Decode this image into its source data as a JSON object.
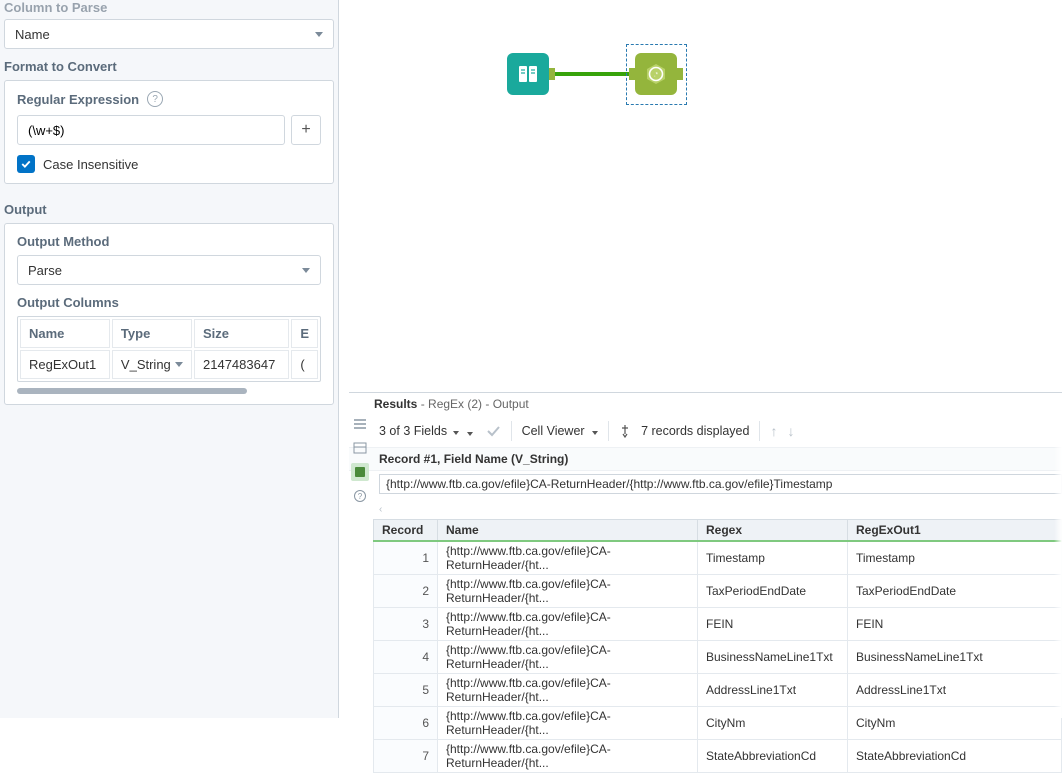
{
  "config": {
    "column_to_parse_label": "Column to Parse",
    "column_to_parse_value": "Name",
    "format_label": "Format to Convert",
    "regex_label": "Regular Expression",
    "regex_value": "(\\w+$)",
    "case_insensitive_label": "Case Insensitive",
    "output_label": "Output",
    "output_method_label": "Output Method",
    "output_method_value": "Parse",
    "output_columns_label": "Output Columns",
    "cols_headers": {
      "name": "Name",
      "type": "Type",
      "size": "Size",
      "expr": "E"
    },
    "cols_row": {
      "name": "RegExOut1",
      "type": "V_String",
      "size": "2147483647",
      "expr": "("
    }
  },
  "results": {
    "title_bold": "Results",
    "title_rest": " - RegEx (2) - Output",
    "toolbar": {
      "fields": "3 of 3 Fields",
      "cell_viewer": "Cell Viewer",
      "records": "7 records displayed"
    },
    "record_band": "Record #1, Field Name (V_String)",
    "record_value": "{http://www.ftb.ca.gov/efile}CA-ReturnHeader/{http://www.ftb.ca.gov/efile}Timestamp",
    "grid_headers": {
      "record": "Record",
      "name": "Name",
      "regex": "Regex",
      "out": "RegExOut1"
    },
    "rows": [
      {
        "n": "1",
        "name": "{http://www.ftb.ca.gov/efile}CA-ReturnHeader/{ht...",
        "regex": "Timestamp",
        "out": "Timestamp"
      },
      {
        "n": "2",
        "name": "{http://www.ftb.ca.gov/efile}CA-ReturnHeader/{ht...",
        "regex": "TaxPeriodEndDate",
        "out": "TaxPeriodEndDate"
      },
      {
        "n": "3",
        "name": "{http://www.ftb.ca.gov/efile}CA-ReturnHeader/{ht...",
        "regex": "FEIN",
        "out": "FEIN"
      },
      {
        "n": "4",
        "name": "{http://www.ftb.ca.gov/efile}CA-ReturnHeader/{ht...",
        "regex": "BusinessNameLine1Txt",
        "out": "BusinessNameLine1Txt"
      },
      {
        "n": "5",
        "name": "{http://www.ftb.ca.gov/efile}CA-ReturnHeader/{ht...",
        "regex": "AddressLine1Txt",
        "out": "AddressLine1Txt"
      },
      {
        "n": "6",
        "name": "{http://www.ftb.ca.gov/efile}CA-ReturnHeader/{ht...",
        "regex": "CityNm",
        "out": "CityNm"
      },
      {
        "n": "7",
        "name": "{http://www.ftb.ca.gov/efile}CA-ReturnHeader/{ht...",
        "regex": "StateAbbreviationCd",
        "out": "StateAbbreviationCd"
      }
    ]
  }
}
